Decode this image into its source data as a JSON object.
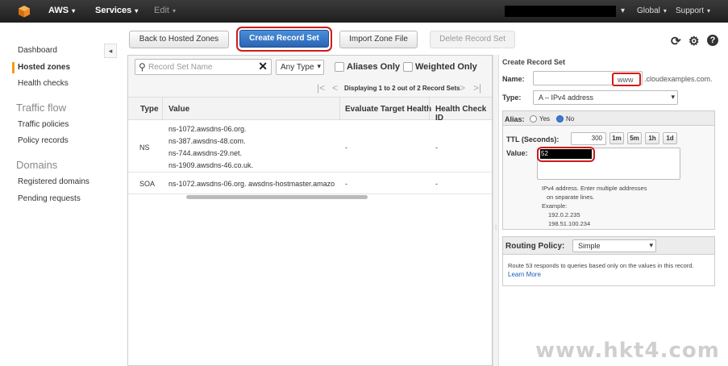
{
  "topbar": {
    "brand": "AWS",
    "services": "Services",
    "edit": "Edit",
    "region": "Global",
    "support": "Support",
    "caret": "▾"
  },
  "sidebar": {
    "items": [
      {
        "label": "Dashboard"
      },
      {
        "label": "Hosted zones"
      },
      {
        "label": "Health checks"
      }
    ],
    "traffic_flow": {
      "heading": "Traffic flow",
      "items": [
        {
          "label": "Traffic policies"
        },
        {
          "label": "Policy records"
        }
      ]
    },
    "domains": {
      "heading": "Domains",
      "items": [
        {
          "label": "Registered domains"
        },
        {
          "label": "Pending requests"
        }
      ]
    },
    "collapse_glyph": "◂"
  },
  "toolbar": {
    "back": "Back to Hosted Zones",
    "create": "Create Record Set",
    "import": "Import Zone File",
    "delete": "Delete Record Set",
    "refresh_glyph": "⟳",
    "settings_glyph": "⚙",
    "help_glyph": "?"
  },
  "filter": {
    "search_placeholder": "Record Set Name",
    "clear_glyph": "✕",
    "search_glyph": "⚲",
    "type_value": "Any Type",
    "aliases_only": "Aliases Only",
    "weighted_only": "Weighted Only",
    "pager_text": "Displaying 1 to 2 out of 2 Record Sets",
    "first_glyph": "|<",
    "prev_glyph": "<",
    "next_glyph": ">",
    "last_glyph": ">|"
  },
  "table": {
    "headers": [
      "Type",
      "Value",
      "Evaluate Target Health",
      "Health Check ID"
    ],
    "rows": [
      {
        "type": "NS",
        "values": [
          "ns-1072.awsdns-06.org.",
          "ns-387.awsdns-48.com.",
          "ns-744.awsdns-29.net.",
          "ns-1909.awsdns-46.co.uk."
        ],
        "eval": "-",
        "hc": "-"
      },
      {
        "type": "SOA",
        "values": [
          "ns-1072.awsdns-06.org. awsdns-hostmaster.amazo"
        ],
        "eval": "-",
        "hc": "-"
      }
    ]
  },
  "form": {
    "title": "Create Record Set",
    "name_label": "Name:",
    "name_value": "www",
    "name_suffix": ".cloudexamples.com.",
    "type_label": "Type:",
    "type_value": "A – IPv4 address",
    "alias_label": "Alias:",
    "alias_yes": "Yes",
    "alias_no": "No",
    "ttl_label": "TTL (Seconds):",
    "ttl_value": "300",
    "ttl_buttons": [
      "1m",
      "5m",
      "1h",
      "1d"
    ],
    "value_label": "Value:",
    "value_prefix": "52",
    "help_lines": [
      "IPv4 address. Enter multiple addresses",
      "on separate lines.",
      "Example:",
      "192.0.2.235",
      "198.51.100.234"
    ],
    "routing_label": "Routing Policy:",
    "routing_value": "Simple",
    "routing_help": "Route 53 responds to queries based only on the values in this record.",
    "learn_more": "Learn More"
  },
  "watermark": "www.hkt4.com",
  "colors": {
    "topbar": "#232323",
    "primary_button": "#2a64b6",
    "highlight": "#d11a1a",
    "active_marker": "#f39c12"
  }
}
